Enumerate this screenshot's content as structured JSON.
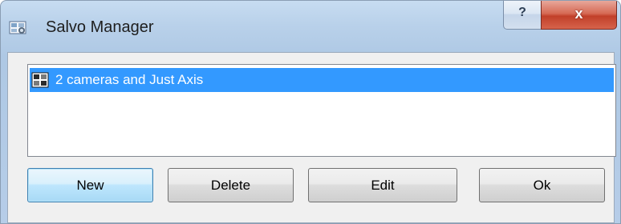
{
  "window": {
    "title": "Salvo Manager",
    "icon": "salvo-app-icon"
  },
  "titlebar_buttons": {
    "help_label": "?",
    "close_label": "x"
  },
  "list": {
    "items": [
      {
        "label": "2 cameras and Just Axis",
        "icon": "camera-grid-icon",
        "selected": true
      }
    ]
  },
  "buttons": {
    "new_label": "New",
    "delete_label": "Delete",
    "edit_label": "Edit",
    "ok_label": "Ok"
  },
  "colors": {
    "selection": "#3399ff",
    "close_button": "#c1402a"
  }
}
